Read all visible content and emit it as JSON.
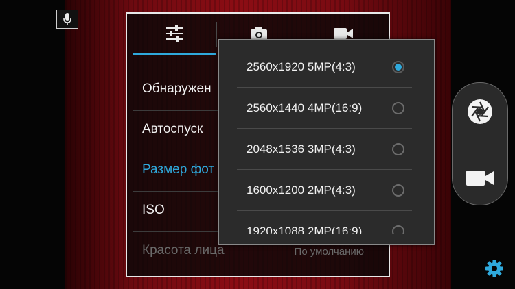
{
  "settings_panel": {
    "tabs": [
      {
        "icon": "sliders-icon"
      },
      {
        "icon": "camera-icon"
      },
      {
        "icon": "video-camera-icon"
      }
    ],
    "rows": [
      {
        "label": "Обнаружен",
        "value": ""
      },
      {
        "label": "Автоспуск",
        "value": ""
      },
      {
        "label": "Размер фот",
        "value": ""
      },
      {
        "label": "ISO",
        "value": ""
      },
      {
        "label": "Красота лица",
        "value": "По умолчанию"
      }
    ]
  },
  "picture_size_popup": {
    "options": [
      {
        "label": "2560x1920 5MP(4:3)",
        "selected": true
      },
      {
        "label": "2560x1440 4MP(16:9)",
        "selected": false
      },
      {
        "label": "2048x1536 3MP(4:3)",
        "selected": false
      },
      {
        "label": "1600x1200 2MP(4:3)",
        "selected": false
      },
      {
        "label": "1920x1088 2MP(16:9)",
        "selected": false
      }
    ]
  },
  "controls": {
    "mic_icon": "microphone-icon",
    "shutter_icon": "shutter-icon",
    "video_icon": "video-camera-icon",
    "settings_icon": "gear-icon"
  },
  "colors": {
    "accent": "#2fa9dc",
    "panel_bg": "#2b2b2b",
    "viewfinder": "#8c0d14"
  }
}
